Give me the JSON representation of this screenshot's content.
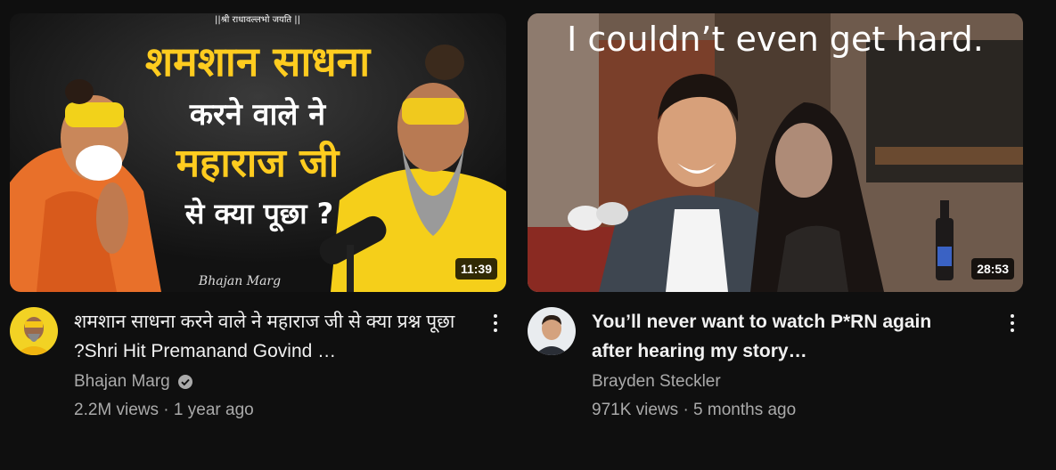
{
  "videos": [
    {
      "thumbnail_text": {
        "top": "||श्री राधावल्लभो जयति ||",
        "line1": "शमशान साधना",
        "line2": "करने वाले ने",
        "line3": "महाराज जी",
        "line4": "से क्या पूछा ?",
        "watermark": "Bhajan Marg"
      },
      "duration": "11:39",
      "title": "शमशान साधना करने वाले ने महाराज जी से क्या प्रश्न पूछा ?Shri Hit Premanand Govind …",
      "channel": "Bhajan Marg",
      "verified": true,
      "stats": "2.2M views · 1 year ago"
    },
    {
      "thumbnail_text": {
        "caption": "I couldn’t even get hard."
      },
      "duration": "28:53",
      "title": "You’ll never want to watch P*RN again after hearing my story…",
      "channel": "Brayden Steckler",
      "verified": false,
      "stats": "971K views · 5 months ago"
    }
  ],
  "colors": {
    "background": "#0f0f0f",
    "title_text": "#f1f1f1",
    "secondary_text": "#aaaaaa",
    "thumbnail_yellow": "#ffcc1f",
    "thumbnail_white": "#ffffff"
  }
}
